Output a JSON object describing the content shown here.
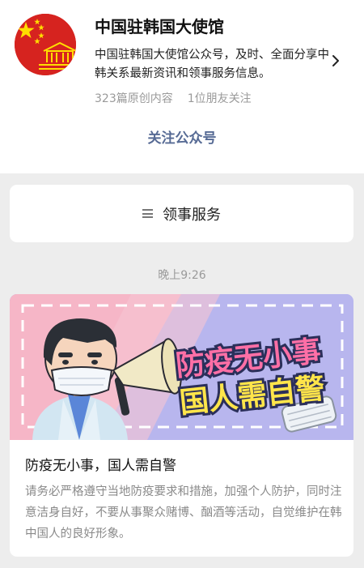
{
  "account": {
    "name": "中国驻韩国大使馆",
    "description": "中国驻韩国大使馆公众号，及时、全面分享中韩关系最新资讯和领事服务信息。",
    "articles_count": "323篇原创内容",
    "friends_following": "1位朋友关注",
    "follow_label": "关注公众号"
  },
  "menu": {
    "label": "领事服务"
  },
  "message": {
    "time": "晚上9:26",
    "article": {
      "cover_text_line1": "防疫无小事",
      "cover_text_line2": "国人需自警",
      "title": "防疫无小事，国人需自警",
      "summary": "请务必严格遵守当地防疫要求和措施，加强个人防护，同时注意洁身自好，不要从事聚众赌博、酗酒等活动，自觉维护在韩中国人的良好形象。"
    }
  },
  "colors": {
    "link_blue": "#576b95",
    "flag_red": "#d6231f",
    "star_yellow": "#ffde00"
  },
  "icons": [
    "emblem-avatar-icon",
    "chevron-right-icon",
    "menu-list-icon"
  ]
}
